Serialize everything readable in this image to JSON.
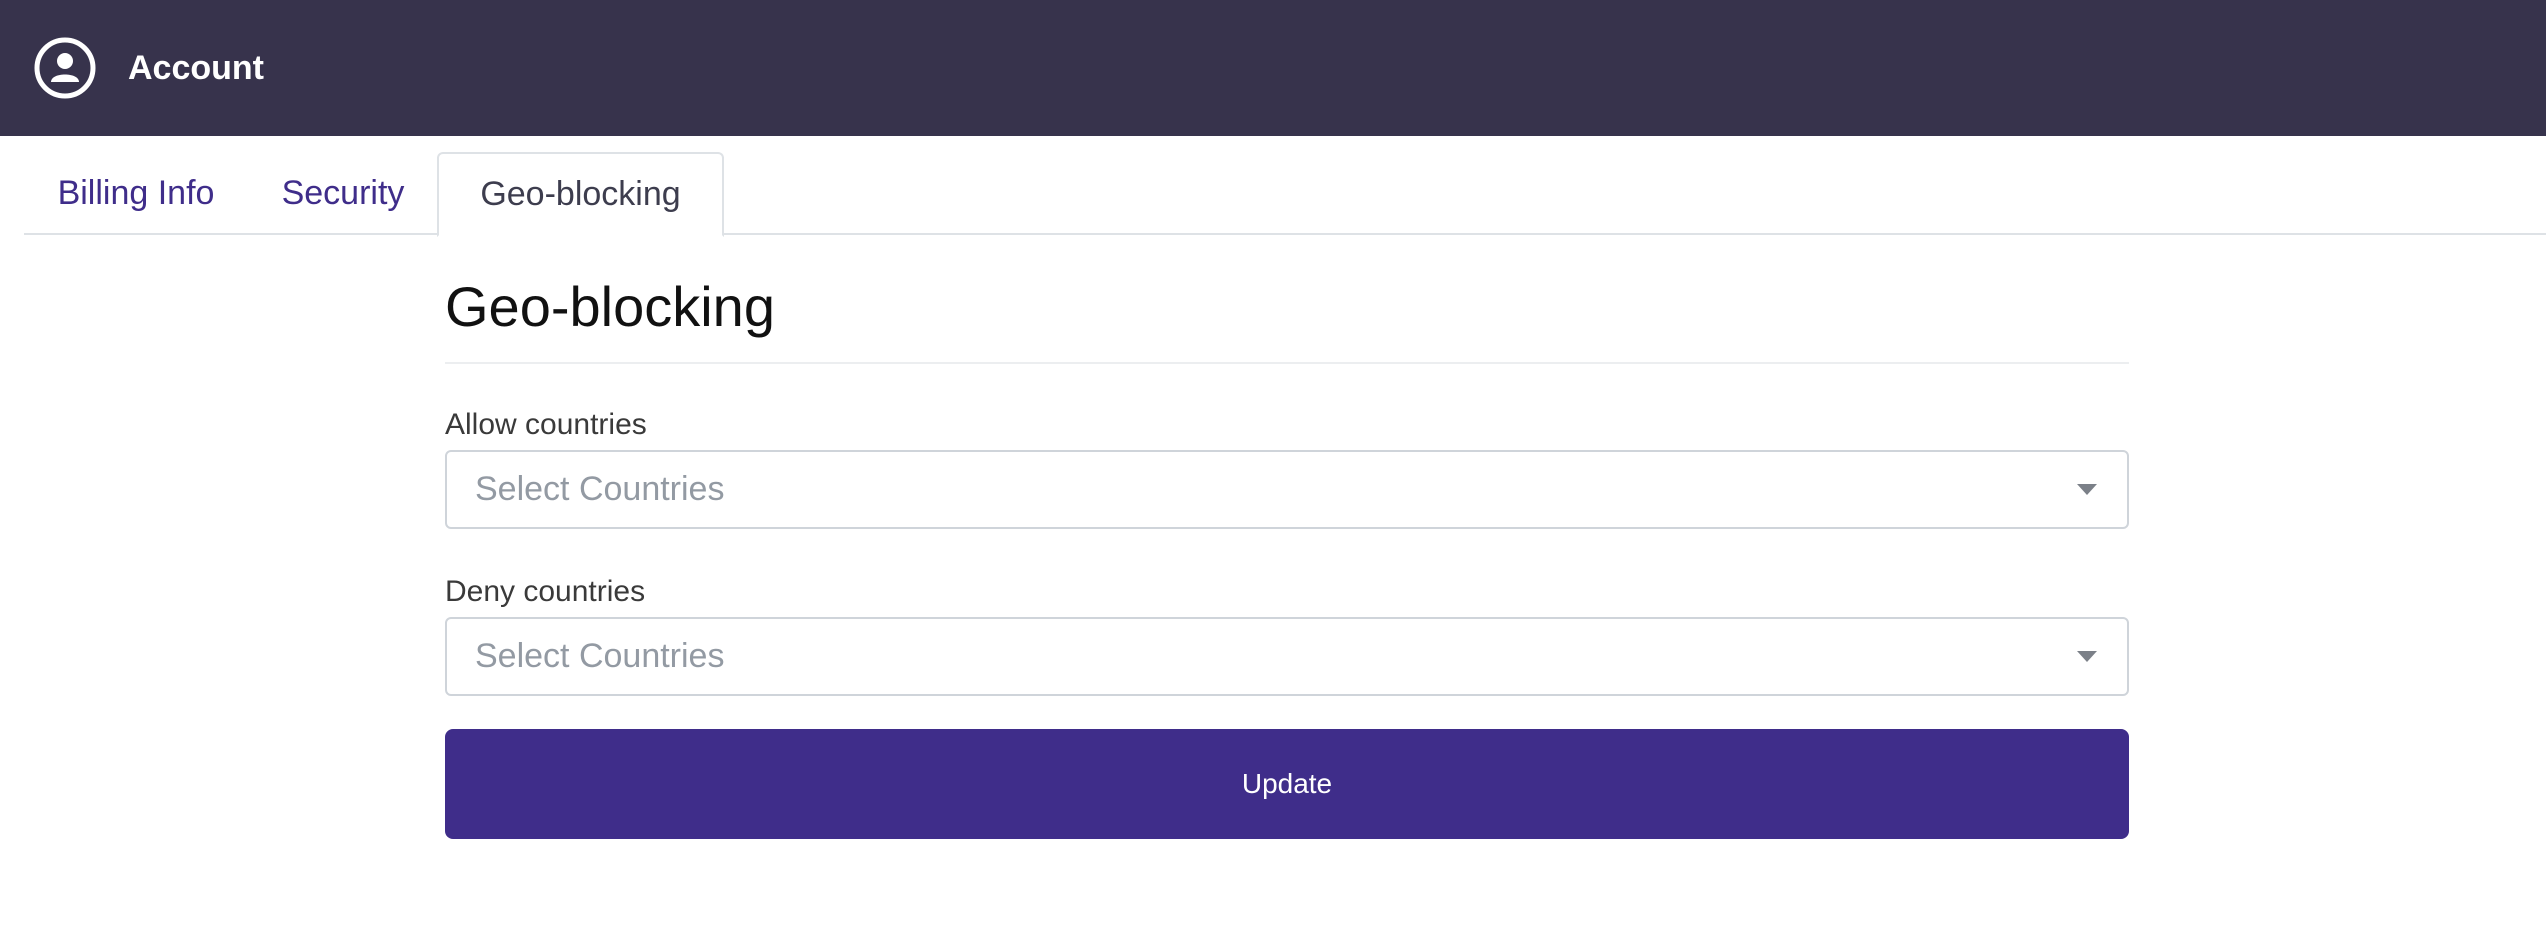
{
  "header": {
    "title": "Account",
    "icon": "user-circle-icon",
    "background_color": "#37334c"
  },
  "tabs": [
    {
      "label": "Billing Info",
      "active": false
    },
    {
      "label": "Security",
      "active": false
    },
    {
      "label": "Geo-blocking",
      "active": true
    }
  ],
  "main": {
    "title": "Geo-blocking",
    "allow": {
      "label": "Allow countries",
      "placeholder": "Select Countries"
    },
    "deny": {
      "label": "Deny countries",
      "placeholder": "Select Countries"
    },
    "update_label": "Update",
    "accent_color": "#3f2d8a"
  }
}
